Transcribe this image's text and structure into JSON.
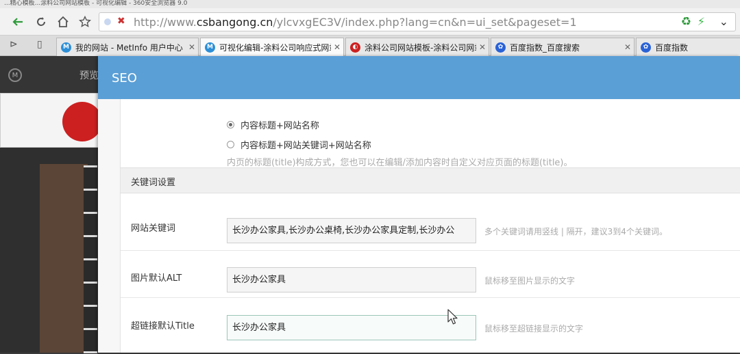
{
  "window_title": "...精心模板...涂料公司网站模板 - 可视化编辑 - 360安全浏览器 9.0",
  "address_bar": {
    "url_prefix": "http://www.",
    "url_domain": "csbangong.cn",
    "url_path": "/ylcvxgEC3V/index.php?lang=cn&n=ui_set&pageset=1"
  },
  "tabs": [
    {
      "label": "我的网站 - MetInfo 用户中心",
      "favicon": "metinfo-icon"
    },
    {
      "label": "可视化编辑-涂料公司响应式网站",
      "favicon": "metinfo-icon",
      "active": true
    },
    {
      "label": "涂料公司网站模板-涂料公司网站",
      "favicon": "swirl-icon"
    },
    {
      "label": "百度指数_百度搜索",
      "favicon": "baidu-paw-icon"
    },
    {
      "label": "百度指数",
      "favicon": "baidu-paw-icon"
    }
  ],
  "background_app": {
    "preview_label": "预览"
  },
  "modal": {
    "title": "SEO"
  },
  "seo": {
    "title_options": [
      {
        "label": "内容标题+网站名称",
        "checked": true
      },
      {
        "label": "内容标题+网站关键词+网站名称",
        "checked": false
      }
    ],
    "title_hint": "内页的标题(title)构成方式，您也可以在编辑/添加内容时自定义对应页面的标题(title)。",
    "section_title": "关键词设置",
    "fields": [
      {
        "label": "网站关键词",
        "value": "长沙办公家具,长沙办公桌椅,长沙办公家具定制,长沙办公",
        "hint": "多个关键词请用竖线 | 隔开，建议3到4个关键词。"
      },
      {
        "label": "图片默认ALT",
        "value": "长沙办公家具",
        "hint": "鼠标移至图片显示的文字"
      },
      {
        "label": "超链接默认Title",
        "value": "长沙办公家具",
        "hint": "鼠标移至超链接显示的文字"
      }
    ]
  }
}
